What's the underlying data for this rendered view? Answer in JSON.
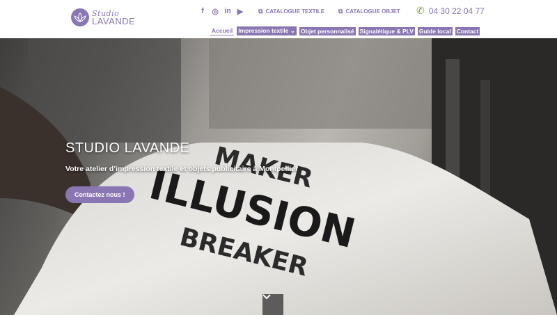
{
  "brand": {
    "line1": "Studio",
    "line2": "LAVANDE"
  },
  "social": [
    "f",
    "◎",
    "in",
    "▶"
  ],
  "top_links": {
    "catalogue_textile": "CATALOGUE TEXTILE",
    "catalogue_objet": "CATALOGUE OBJET"
  },
  "phone": "04 30 22 04 77",
  "nav": {
    "items": [
      "Accueil",
      "Impression textile",
      "Objet personnalisé",
      "Signalétique & PLV",
      "Guide local",
      "Contact"
    ]
  },
  "hero": {
    "title": "STUDIO LAVANDE",
    "subtitle": "Votre atelier d’impression textile et objets publicitaire à Montpellier",
    "cta": "Contactez nous !",
    "shirt_text": {
      "line1": "MAKER",
      "line2": "ILLUSION",
      "line3": "BREAKER"
    }
  },
  "colors": {
    "accent": "#8a76b3",
    "phone_icon": "#7aa33f"
  }
}
